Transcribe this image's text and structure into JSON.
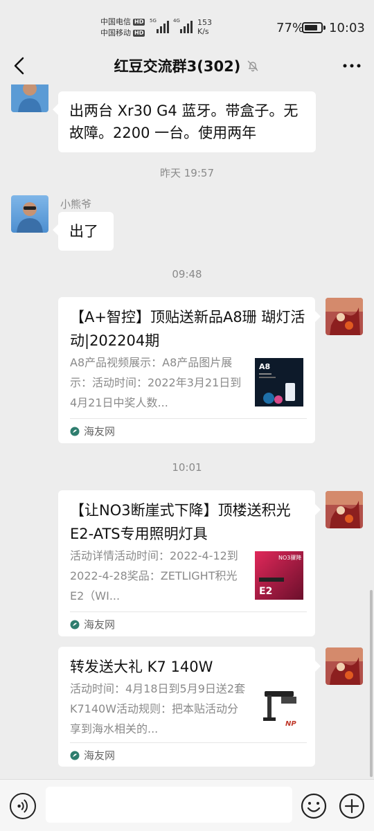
{
  "status_bar": {
    "carrier1": "中国电信",
    "carrier2": "中国移动",
    "hd": "HD",
    "net1": "5G",
    "net2": "4G",
    "speed_value": "153",
    "speed_unit": "K/s",
    "battery_pct": "77%",
    "battery_level": 0.77,
    "time": "10:03"
  },
  "header": {
    "title": "红豆交流群3(302)",
    "back_icon": "chevron-left-icon",
    "mute_icon": "bell-off-icon",
    "more_icon": "more-dots-icon"
  },
  "messages": {
    "m1_text": "出两台 Xr30 G4 蓝牙。带盒子。无故障。2200 一台。使用两年",
    "ts1": "昨天 19:57",
    "m2_sender": "小熊爷",
    "m2_text": "出了",
    "ts2": "09:48",
    "ts3": "10:01"
  },
  "cards": [
    {
      "title": "【A+智控】顶贴送新品A8珊 瑚灯活动|202204期",
      "desc": "A8产品视频展示：A8产品图片展示：活动时间：2022年3月21日到4月21日中奖人数...",
      "thumb_label": "A8",
      "source": "海友网"
    },
    {
      "title": "【让NO3断崖式下降】顶楼送积光E2-ATS专用照明灯具",
      "desc": "活动详情活动时间：2022-4-12到2022-4-28奖品：ZETLIGHT积光E2（WI...",
      "thumb_label": "E2",
      "thumb_badge": "NO3骤降 50不重样",
      "source": "海友网"
    },
    {
      "title": "转发送大礼 K7 140W",
      "desc": "活动时间：4月18日到5月9日送2套K7140W活动规则：把本贴活动分享到海水相关的...",
      "source": "海友网"
    }
  ],
  "input_bar": {
    "placeholder": "",
    "voice_icon": "voice-icon",
    "emoji_icon": "emoji-icon",
    "plus_icon": "plus-icon"
  },
  "colors": {
    "background": "#ededed",
    "bubble": "#ffffff",
    "meta_text": "#8a8a8a",
    "source_icon": "#2e7d6e"
  }
}
